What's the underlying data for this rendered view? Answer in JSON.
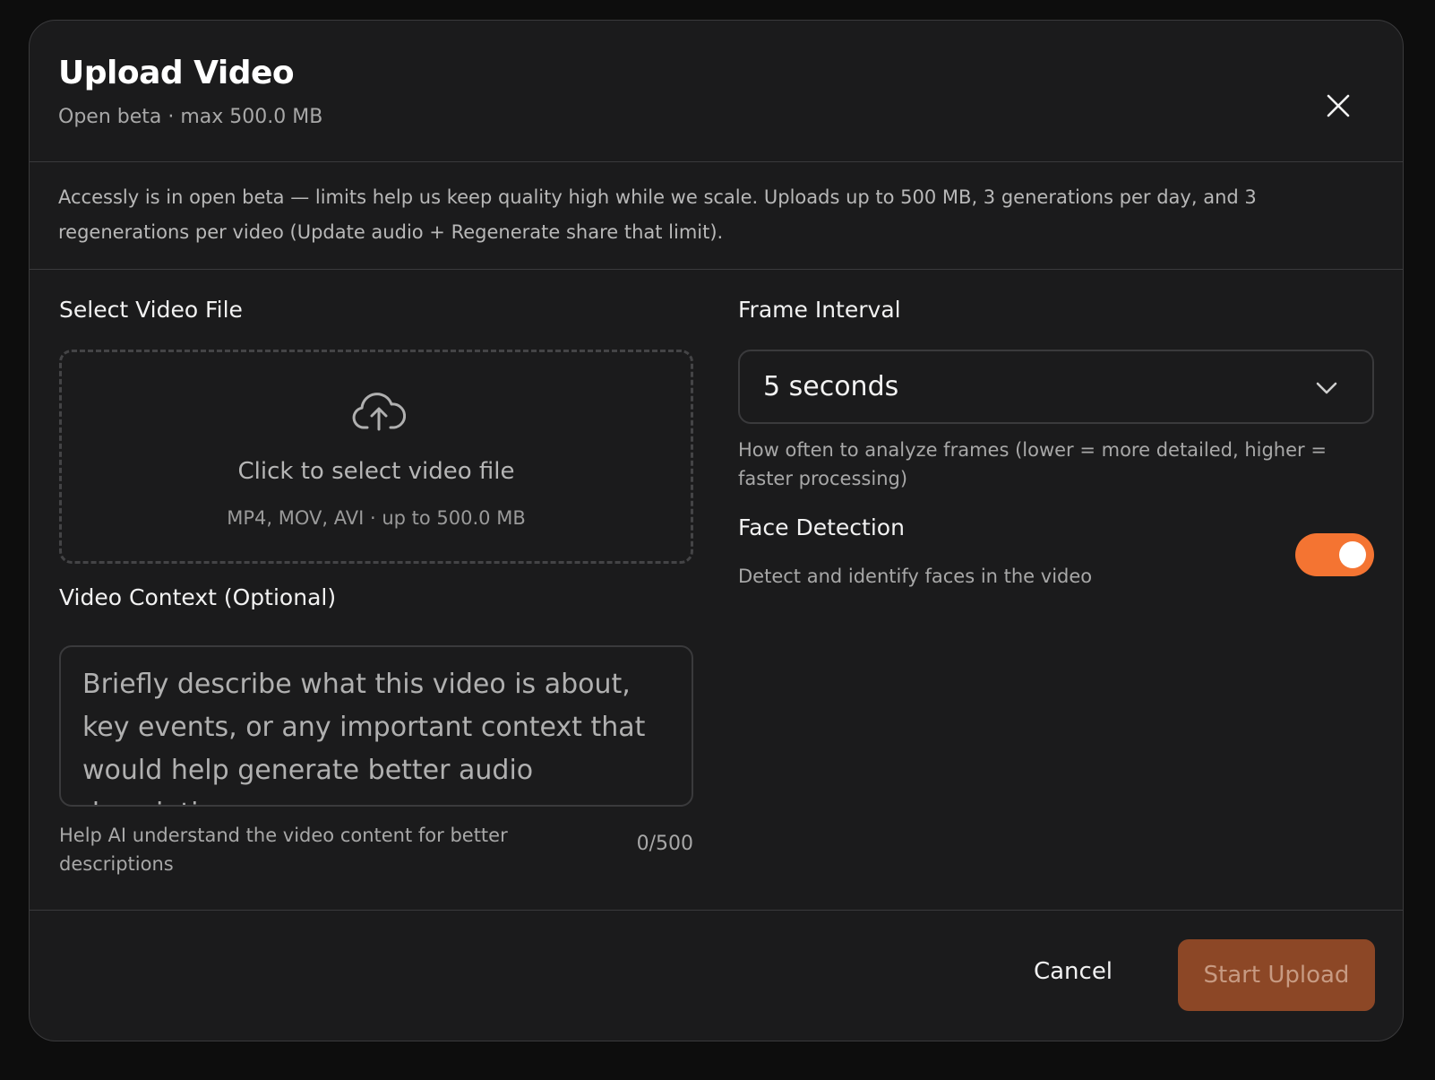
{
  "header": {
    "title": "Upload Video",
    "subtitle": "Open beta · max 500.0 MB",
    "close_icon": "close-icon"
  },
  "notice": {
    "text": "Accessly is in open beta — limits help us keep quality high while we scale. Uploads up to 500 MB, 3 generations per day, and 3 regenerations per video (Update audio + Regenerate share that limit)."
  },
  "file": {
    "label": "Select Video File",
    "icon": "cloud-upload-icon",
    "title": "Click to select video file",
    "formats": "MP4, MOV, AVI · up to 500.0 MB"
  },
  "context": {
    "label": "Video Context (Optional)",
    "value": "",
    "placeholder": "Briefly describe what this video is about, key events, or any important context that would help generate better audio descriptions...",
    "hint": "Help AI understand the video content for better descriptions",
    "counter": "0/500"
  },
  "frame_interval": {
    "label": "Frame Interval",
    "selected": "5 seconds",
    "icon": "chevron-down-icon",
    "help": "How often to analyze frames (lower = more detailed, higher = faster processing)"
  },
  "face_detection": {
    "label": "Face Detection",
    "description": "Detect and identify faces in the video",
    "enabled": true
  },
  "footer": {
    "cancel_label": "Cancel",
    "start_label": "Start Upload"
  },
  "colors": {
    "accent": "#f47432",
    "start_button_bg": "#8c4726",
    "modal_bg": "#1b1b1c",
    "border": "#3a3a3c"
  }
}
